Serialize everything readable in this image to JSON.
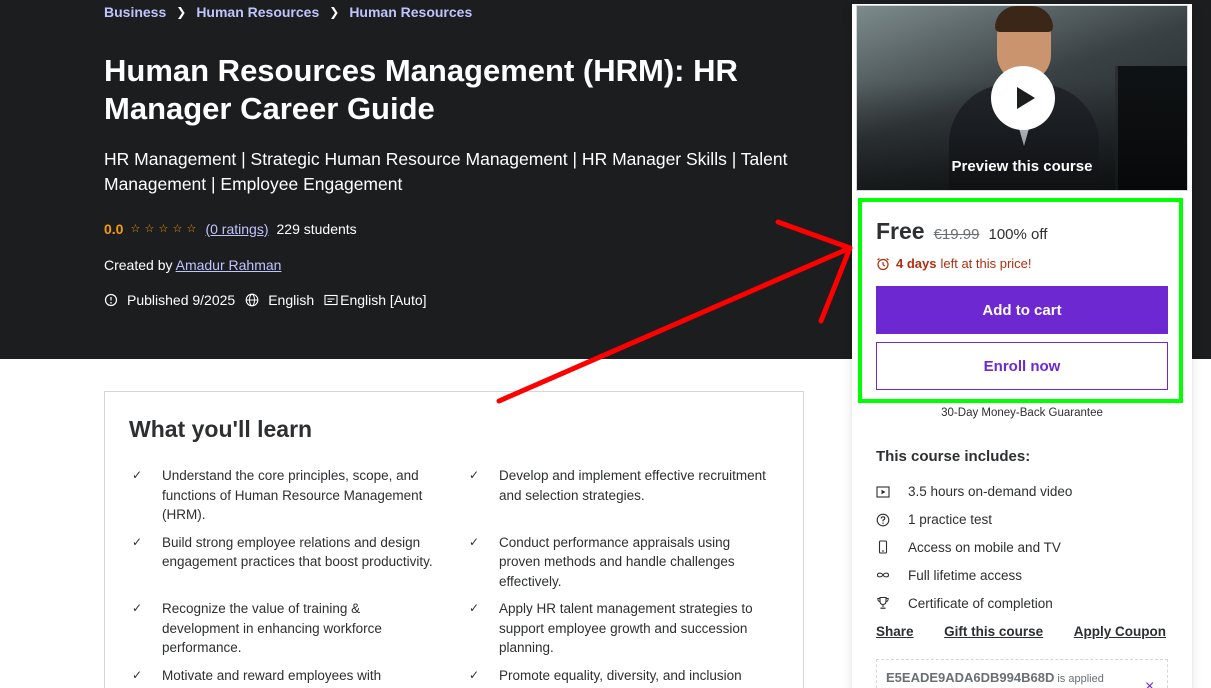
{
  "breadcrumb": [
    "Business",
    "Human Resources",
    "Human Resources"
  ],
  "course": {
    "title": "Human Resources Management (HRM): HR Manager Career Guide",
    "subtitle": "HR Management | Strategic Human Resource Management | HR Manager Skills | Talent Management | Employee Engagement",
    "rating": "0.0",
    "rating_stars": 0,
    "ratings_count": "(0 ratings)",
    "students": "229 students",
    "created_by_label": "Created by",
    "instructor": "Amadur Rahman",
    "published": "Published 9/2025",
    "language": "English",
    "captions": "English [Auto]"
  },
  "learn": {
    "heading": "What you'll learn",
    "items": [
      "Understand the core principles, scope, and functions of Human Resource Management (HRM).",
      "Develop and implement effective recruitment and selection strategies.",
      "Build strong employee relations and design engagement practices that boost productivity.",
      "Conduct performance appraisals using proven methods and handle challenges effectively.",
      "Recognize the value of training & development in enhancing workforce performance.",
      "Apply HR talent management strategies to support employee growth and succession planning.",
      "Motivate and reward employees with",
      "Promote equality, diversity, and inclusion"
    ]
  },
  "sidebar": {
    "preview_label": "Preview this course",
    "price": "Free",
    "original_price": "€19.99",
    "discount": "100% off",
    "timer_bold": "4 days",
    "timer_rest": "left at this price!",
    "add_to_cart": "Add to cart",
    "enroll_now": "Enroll now",
    "guarantee": "30-Day Money-Back Guarantee",
    "includes_title": "This course includes:",
    "includes": [
      {
        "icon": "video-icon",
        "text": "3.5 hours on-demand video"
      },
      {
        "icon": "question-icon",
        "text": "1 practice test"
      },
      {
        "icon": "mobile-icon",
        "text": "Access on mobile and TV"
      },
      {
        "icon": "infinity-icon",
        "text": "Full lifetime access"
      },
      {
        "icon": "trophy-icon",
        "text": "Certificate of completion"
      }
    ],
    "share": "Share",
    "gift": "Gift this course",
    "apply_coupon": "Apply Coupon",
    "coupon_code": "E5EADE9ADA6DB994B68D",
    "coupon_applied": "is applied",
    "coupon_remove": "×"
  },
  "colors": {
    "hero_bg": "#1c1d1f",
    "link": "#c0c4fc",
    "rating": "#f69c08",
    "primary": "#6d28d2",
    "urgent": "#b32d0f",
    "highlight_box": "#00ff00",
    "annotation_arrow": "#ff0000"
  }
}
